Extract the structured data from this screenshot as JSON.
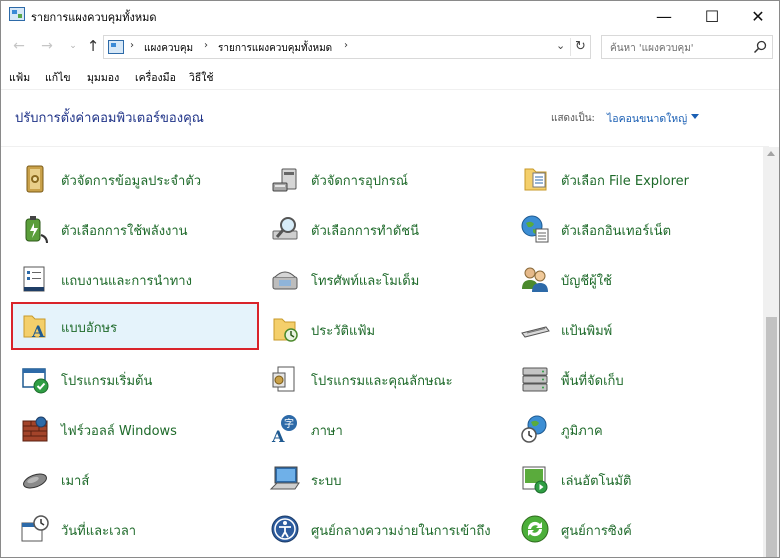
{
  "window": {
    "title": "รายการแผงควบคุมทั้งหมด",
    "min_glyph": "—",
    "max_glyph": "☐",
    "close_glyph": "✕"
  },
  "nav": {
    "back_glyph": "←",
    "forward_glyph": "→",
    "recent_glyph": "⌄",
    "up_glyph": "↑",
    "breadcrumb": [
      "แผงควบคุม",
      "รายการแผงควบคุมทั้งหมด"
    ],
    "crumb_sep": "›",
    "dropdown_glyph": "⌄",
    "refresh_glyph": "↻",
    "search_placeholder": "ค้นหา 'แผงควบคุม'"
  },
  "menu": {
    "items": [
      "แฟ้ม",
      "แก้ไข",
      "มุมมอง",
      "เครื่องมือ",
      "วิธีใช้"
    ]
  },
  "header": {
    "title": "ปรับการตั้งค่าคอมพิวเตอร์ของคุณ",
    "viewby_label": "แสดงเป็น:",
    "viewby_value": "ไอคอนขนาดใหญ่"
  },
  "items": [
    {
      "label": "ตัวจัดการข้อมูลประจำตัว",
      "icon": "credential-manager-icon"
    },
    {
      "label": "ตัวจัดการอุปกรณ์",
      "icon": "device-manager-icon"
    },
    {
      "label": "ตัวเลือก File Explorer",
      "icon": "file-explorer-options-icon"
    },
    {
      "label": "ตัวเลือกการใช้พลังงาน",
      "icon": "power-options-icon"
    },
    {
      "label": "ตัวเลือกการทำดัชนี",
      "icon": "indexing-options-icon"
    },
    {
      "label": "ตัวเลือกอินเทอร์เน็ต",
      "icon": "internet-options-icon"
    },
    {
      "label": "แถบงานและการนำทาง",
      "icon": "taskbar-navigation-icon"
    },
    {
      "label": "โทรศัพท์และโมเด็ม",
      "icon": "phone-modem-icon"
    },
    {
      "label": "บัญชีผู้ใช้",
      "icon": "user-accounts-icon"
    },
    {
      "label": "แบบอักษร",
      "icon": "fonts-icon",
      "selected": true
    },
    {
      "label": "ประวัติแฟ้ม",
      "icon": "file-history-icon"
    },
    {
      "label": "แป้นพิมพ์",
      "icon": "keyboard-icon"
    },
    {
      "label": "โปรแกรมเริ่มต้น",
      "icon": "default-programs-icon"
    },
    {
      "label": "โปรแกรมและคุณลักษณะ",
      "icon": "programs-features-icon"
    },
    {
      "label": "พื้นที่จัดเก็บ",
      "icon": "storage-spaces-icon"
    },
    {
      "label": "ไฟร์วอลล์ Windows",
      "icon": "windows-firewall-icon"
    },
    {
      "label": "ภาษา",
      "icon": "language-icon"
    },
    {
      "label": "ภูมิภาค",
      "icon": "region-icon"
    },
    {
      "label": "เมาส์",
      "icon": "mouse-icon"
    },
    {
      "label": "ระบบ",
      "icon": "system-icon"
    },
    {
      "label": "เล่นอัตโนมัติ",
      "icon": "autoplay-icon"
    },
    {
      "label": "วันที่และเวลา",
      "icon": "date-time-icon"
    },
    {
      "label": "ศูนย์กลางความง่ายในการเข้าถึง",
      "icon": "ease-of-access-icon"
    },
    {
      "label": "ศูนย์การซิงค์",
      "icon": "sync-center-icon"
    }
  ],
  "colors": {
    "item_label": "#1e6a2a",
    "title": "#1e3287",
    "selection_border": "#d9232a",
    "selection_bg": "#e5f3fb"
  }
}
